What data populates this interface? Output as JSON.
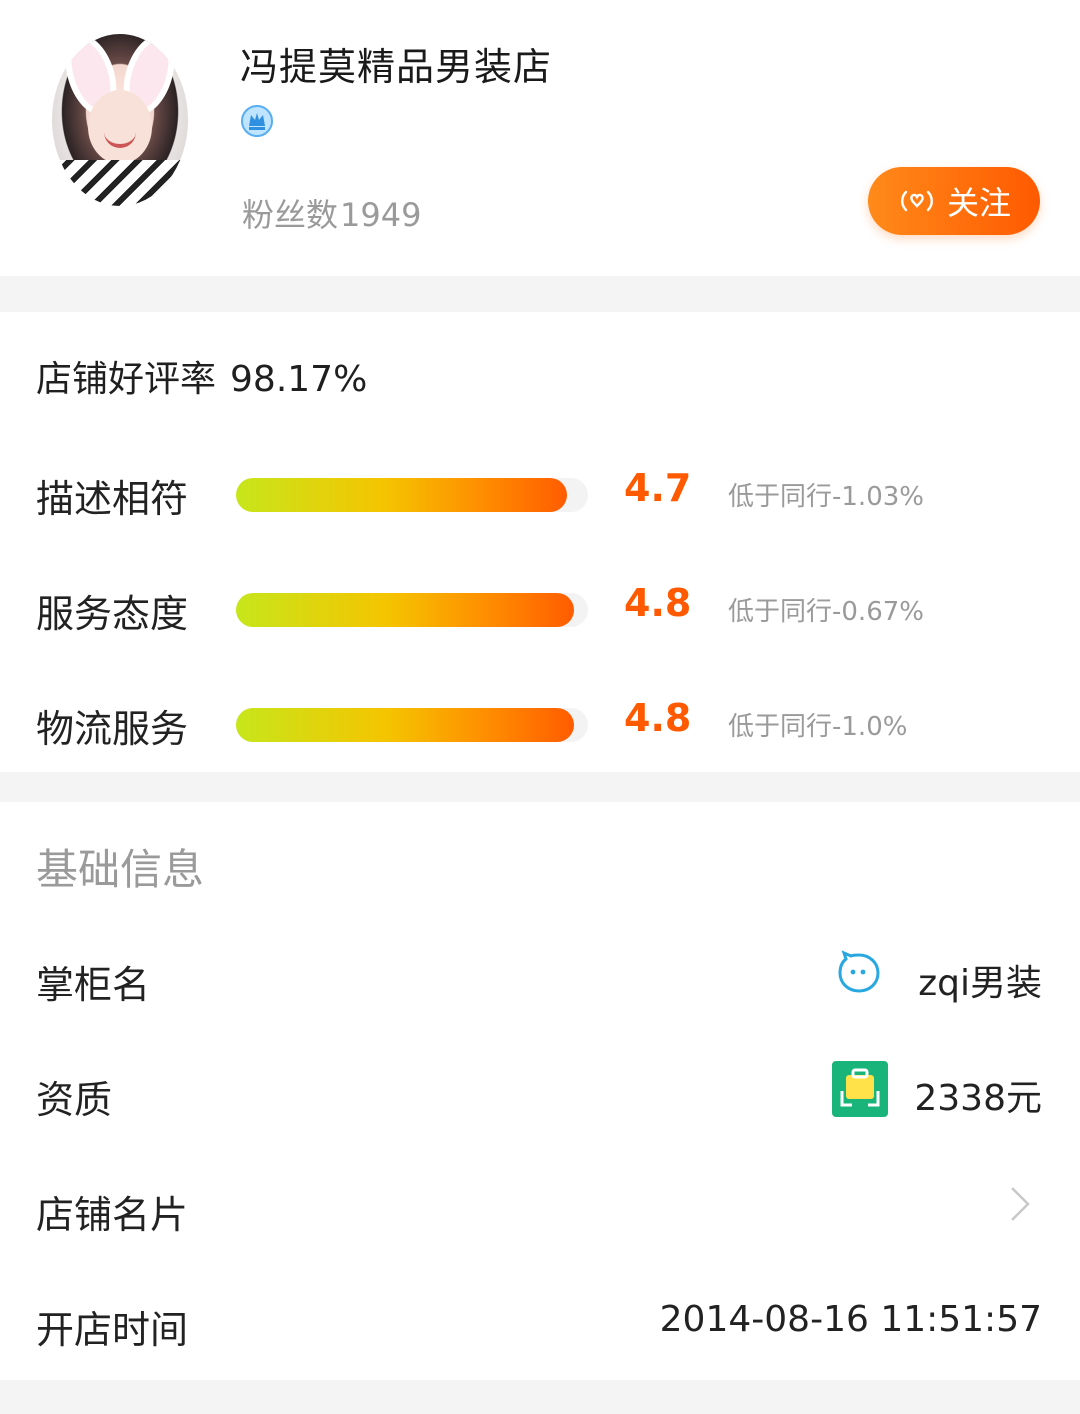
{
  "shop": {
    "name": "冯提莫精品男装店",
    "fans_label": "粉丝数",
    "fans_count": "1949",
    "follow_label": "关注",
    "icons": [
      "crown-icon",
      "wave-icon"
    ]
  },
  "ratings": {
    "good_rate_label": "店铺好评率",
    "good_rate_value": "98.17%",
    "items": [
      {
        "label": "描述相符",
        "score": "4.7",
        "fill": 0.94,
        "compare": "低于同行-1.03%"
      },
      {
        "label": "服务态度",
        "score": "4.8",
        "fill": 0.96,
        "compare": "低于同行-0.67%"
      },
      {
        "label": "物流服务",
        "score": "4.8",
        "fill": 0.96,
        "compare": "低于同行-1.0%"
      }
    ],
    "colors": {
      "score": "#ff5a00",
      "bar_start": "#c7e61b",
      "bar_end": "#ff5c00"
    }
  },
  "basic_info": {
    "title": "基础信息",
    "rows": [
      {
        "label": "掌柜名",
        "value": "zqi男装",
        "icon": "bubble-icon"
      },
      {
        "label": "资质",
        "value": "2338元",
        "icon": "bag-icon"
      },
      {
        "label": "店铺名片",
        "value": "",
        "icon": "chevron-right-icon"
      },
      {
        "label": "开店时间",
        "value": "2014-08-16 11:51:57"
      }
    ]
  }
}
